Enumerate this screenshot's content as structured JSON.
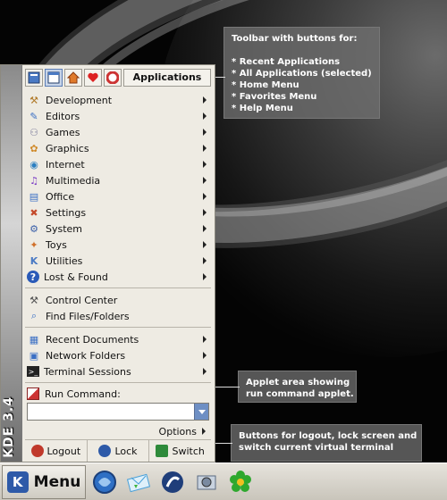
{
  "callouts": {
    "toolbar": {
      "lines": [
        "Toolbar with buttons for:",
        "",
        "* Recent Applications",
        "* All Applications (selected)",
        "* Home Menu",
        "* Favorites Menu",
        "* Help Menu"
      ]
    },
    "applet": {
      "lines": [
        "Applet area showing",
        "run command applet."
      ]
    },
    "buttons": {
      "lines": [
        "Buttons for logout, lock screen and",
        "switch current virtual terminal"
      ]
    }
  },
  "sidebar": {
    "text": "KDE 3.4"
  },
  "toolbar": {
    "buttons": [
      {
        "icon": "recent-applications-icon",
        "selected": false
      },
      {
        "icon": "all-applications-icon",
        "selected": true
      },
      {
        "icon": "home-icon",
        "selected": false
      },
      {
        "icon": "favorites-heart-icon",
        "selected": false
      },
      {
        "icon": "help-lifebuoy-icon",
        "selected": false
      }
    ],
    "label": "Applications"
  },
  "categories": [
    {
      "label": "Development",
      "icon": "hammer-icon",
      "color": "#b07a2a",
      "glyph": "🔨"
    },
    {
      "label": "Editors",
      "icon": "editor-pencil-icon",
      "color": "#3a6fc4",
      "glyph": "✎"
    },
    {
      "label": "Games",
      "icon": "gamepad-icon",
      "color": "#7a7a9a",
      "glyph": "⚇"
    },
    {
      "label": "Graphics",
      "icon": "palette-icon",
      "color": "#d08a2a",
      "glyph": "🎨"
    },
    {
      "label": "Internet",
      "icon": "globe-icon",
      "color": "#2c7fc0",
      "glyph": "🌐"
    },
    {
      "label": "Multimedia",
      "icon": "multimedia-icon",
      "color": "#7a3cc4",
      "glyph": "♫"
    },
    {
      "label": "Office",
      "icon": "office-icon",
      "color": "#3a6fc4",
      "glyph": "▤"
    },
    {
      "label": "Settings",
      "icon": "settings-tools-icon",
      "color": "#c44a2a",
      "glyph": "✖"
    },
    {
      "label": "System",
      "icon": "system-icon",
      "color": "#3a5fa8",
      "glyph": "⚙"
    },
    {
      "label": "Toys",
      "icon": "toys-icon",
      "color": "#d0702a",
      "glyph": "✦"
    },
    {
      "label": "Utilities",
      "icon": "utilities-icon",
      "color": "#4a7ac4",
      "glyph": "K"
    },
    {
      "label": "Lost & Found",
      "icon": "help-question-icon",
      "color": "#2a5ab8",
      "glyph": "?"
    }
  ],
  "tools": [
    {
      "label": "Control Center",
      "icon": "control-center-icon",
      "glyph": "⚒"
    },
    {
      "label": "Find Files/Folders",
      "icon": "find-files-icon",
      "glyph": "🔍"
    }
  ],
  "places": [
    {
      "label": "Recent Documents",
      "icon": "recent-documents-icon",
      "glyph": "▦"
    },
    {
      "label": "Network Folders",
      "icon": "network-folders-icon",
      "glyph": "🖧"
    },
    {
      "label": "Terminal Sessions",
      "icon": "terminal-icon",
      "glyph": ">_"
    }
  ],
  "run": {
    "label": "Run Command:",
    "value": "",
    "options_label": "Options"
  },
  "actions": [
    {
      "label": "Logout",
      "icon": "logout-icon",
      "color": "#c0392b"
    },
    {
      "label": "Lock",
      "icon": "lock-icon",
      "color": "#2e5aa8"
    },
    {
      "label": "Switch",
      "icon": "switch-user-icon",
      "color": "#2e8a3a"
    }
  ],
  "taskbar": {
    "menu_label": "Menu",
    "launchers": [
      {
        "icon": "konqueror-browser-icon",
        "color": "#2e6fc4"
      },
      {
        "icon": "kmail-icon",
        "color": "#4aa0d8"
      },
      {
        "icon": "terminal-launcher-icon",
        "color": "#1f3e7a"
      },
      {
        "icon": "digikam-photo-icon",
        "color": "#7a8aa0"
      },
      {
        "icon": "icq-flower-icon",
        "color": "#2ea82e"
      }
    ]
  }
}
